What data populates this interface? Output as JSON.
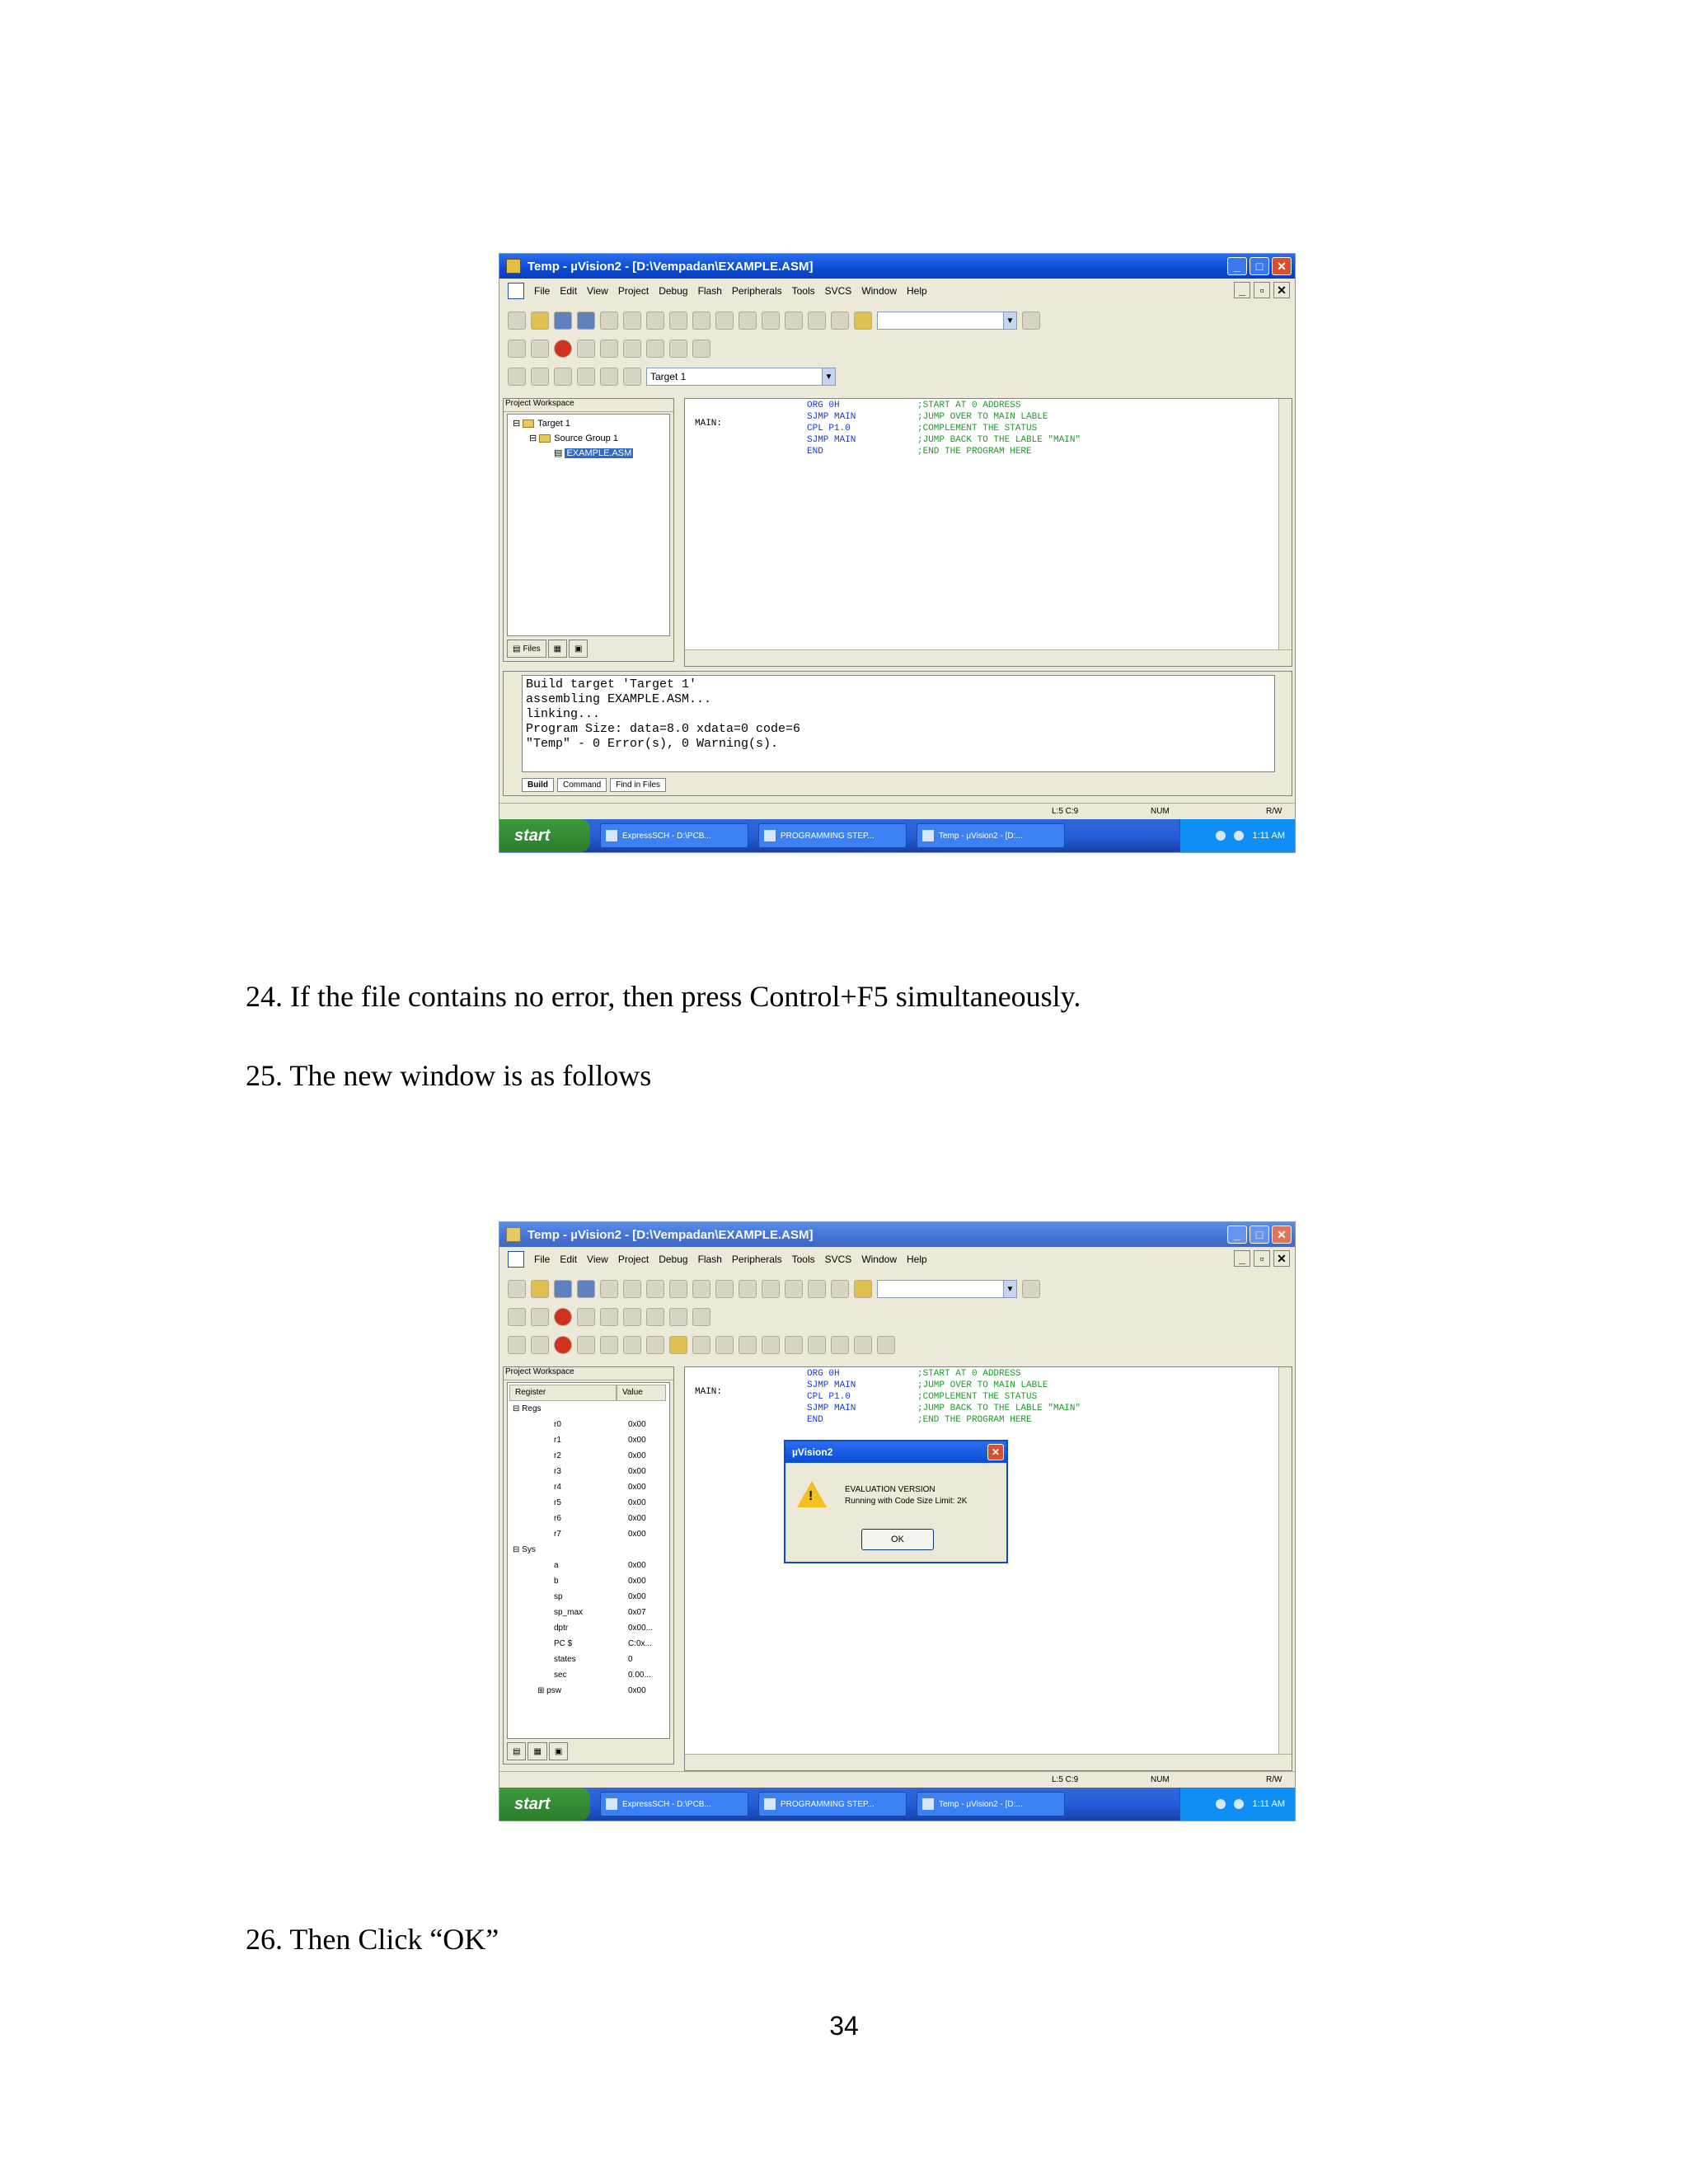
{
  "window1": {
    "title": "Temp - µVision2 - [D:\\Vempadan\\EXAMPLE.ASM]",
    "menu": [
      "File",
      "Edit",
      "View",
      "Project",
      "Debug",
      "Flash",
      "Peripherals",
      "Tools",
      "SVCS",
      "Window",
      "Help"
    ],
    "target_combo": "Target 1",
    "workspace_title": "Project Workspace",
    "tree": [
      "Target 1",
      "Source Group 1",
      "EXAMPLE.ASM"
    ],
    "ws_tabs": [
      "Files",
      "",
      ""
    ],
    "code": [
      {
        "label": "",
        "instr": "ORG 0H",
        "comment": ";START AT 0 ADDRESS"
      },
      {
        "label": "",
        "instr": "SJMP MAIN",
        "comment": ";JUMP OVER TO MAIN LABLE"
      },
      {
        "label": "MAIN:",
        "instr": "CPL P1.0",
        "comment": ";COMPLEMENT THE STATUS"
      },
      {
        "label": "",
        "instr": "SJMP MAIN",
        "comment": ";JUMP BACK TO THE LABLE \"MAIN\""
      },
      {
        "label": "",
        "instr": "END",
        "comment": ";END THE PROGRAM HERE"
      }
    ],
    "output": [
      "Build target 'Target 1'",
      "assembling EXAMPLE.ASM...",
      "linking...",
      "Program Size: data=8.0 xdata=0 code=6",
      "\"Temp\" - 0 Error(s), 0 Warning(s)."
    ],
    "output_tabs": [
      "Build",
      "Command",
      "Find in Files"
    ],
    "status": {
      "pos": "L:5 C:9",
      "num": "NUM",
      "rw": "R/W"
    },
    "taskbar": {
      "start": "start",
      "tasks": [
        "ExpressSCH - D:\\PCB...",
        "PROGRAMMING STEP...",
        "Temp - µVision2 - [D:..."
      ],
      "clock": "1:11 AM"
    }
  },
  "window2": {
    "title": "Temp - µVision2 - [D:\\Vempadan\\EXAMPLE.ASM]",
    "workspace_title": "Project Workspace",
    "reg_header": [
      "Register",
      "Value"
    ],
    "regs": [
      {
        "name": "Regs",
        "value": ""
      },
      {
        "name": "r0",
        "value": "0x00"
      },
      {
        "name": "r1",
        "value": "0x00"
      },
      {
        "name": "r2",
        "value": "0x00"
      },
      {
        "name": "r3",
        "value": "0x00"
      },
      {
        "name": "r4",
        "value": "0x00"
      },
      {
        "name": "r5",
        "value": "0x00"
      },
      {
        "name": "r6",
        "value": "0x00"
      },
      {
        "name": "r7",
        "value": "0x00"
      },
      {
        "name": "Sys",
        "value": ""
      },
      {
        "name": "a",
        "value": "0x00"
      },
      {
        "name": "b",
        "value": "0x00"
      },
      {
        "name": "sp",
        "value": "0x00"
      },
      {
        "name": "sp_max",
        "value": "0x07"
      },
      {
        "name": "dptr",
        "value": "0x00..."
      },
      {
        "name": "PC $",
        "value": "C:0x..."
      },
      {
        "name": "states",
        "value": "0"
      },
      {
        "name": "sec",
        "value": "0.00..."
      },
      {
        "name": "psw",
        "value": "0x00"
      }
    ],
    "dialog": {
      "title": "µVision2",
      "line1": "EVALUATION VERSION",
      "line2": "Running with Code Size Limit: 2K",
      "ok": "OK"
    },
    "status": {
      "pos": "L:5 C:9",
      "num": "NUM",
      "rw": "R/W"
    }
  },
  "document": {
    "step24": "24. If the file contains no error, then press Control+F5 simultaneously.",
    "step25": "25. The new window is as follows",
    "step26": "26. Then Click “OK”",
    "page_number": "34"
  },
  "colors": {
    "xp_blue": "#0a4bd2",
    "code_blue": "#1a3ad0",
    "code_green": "#1e9a2a"
  }
}
